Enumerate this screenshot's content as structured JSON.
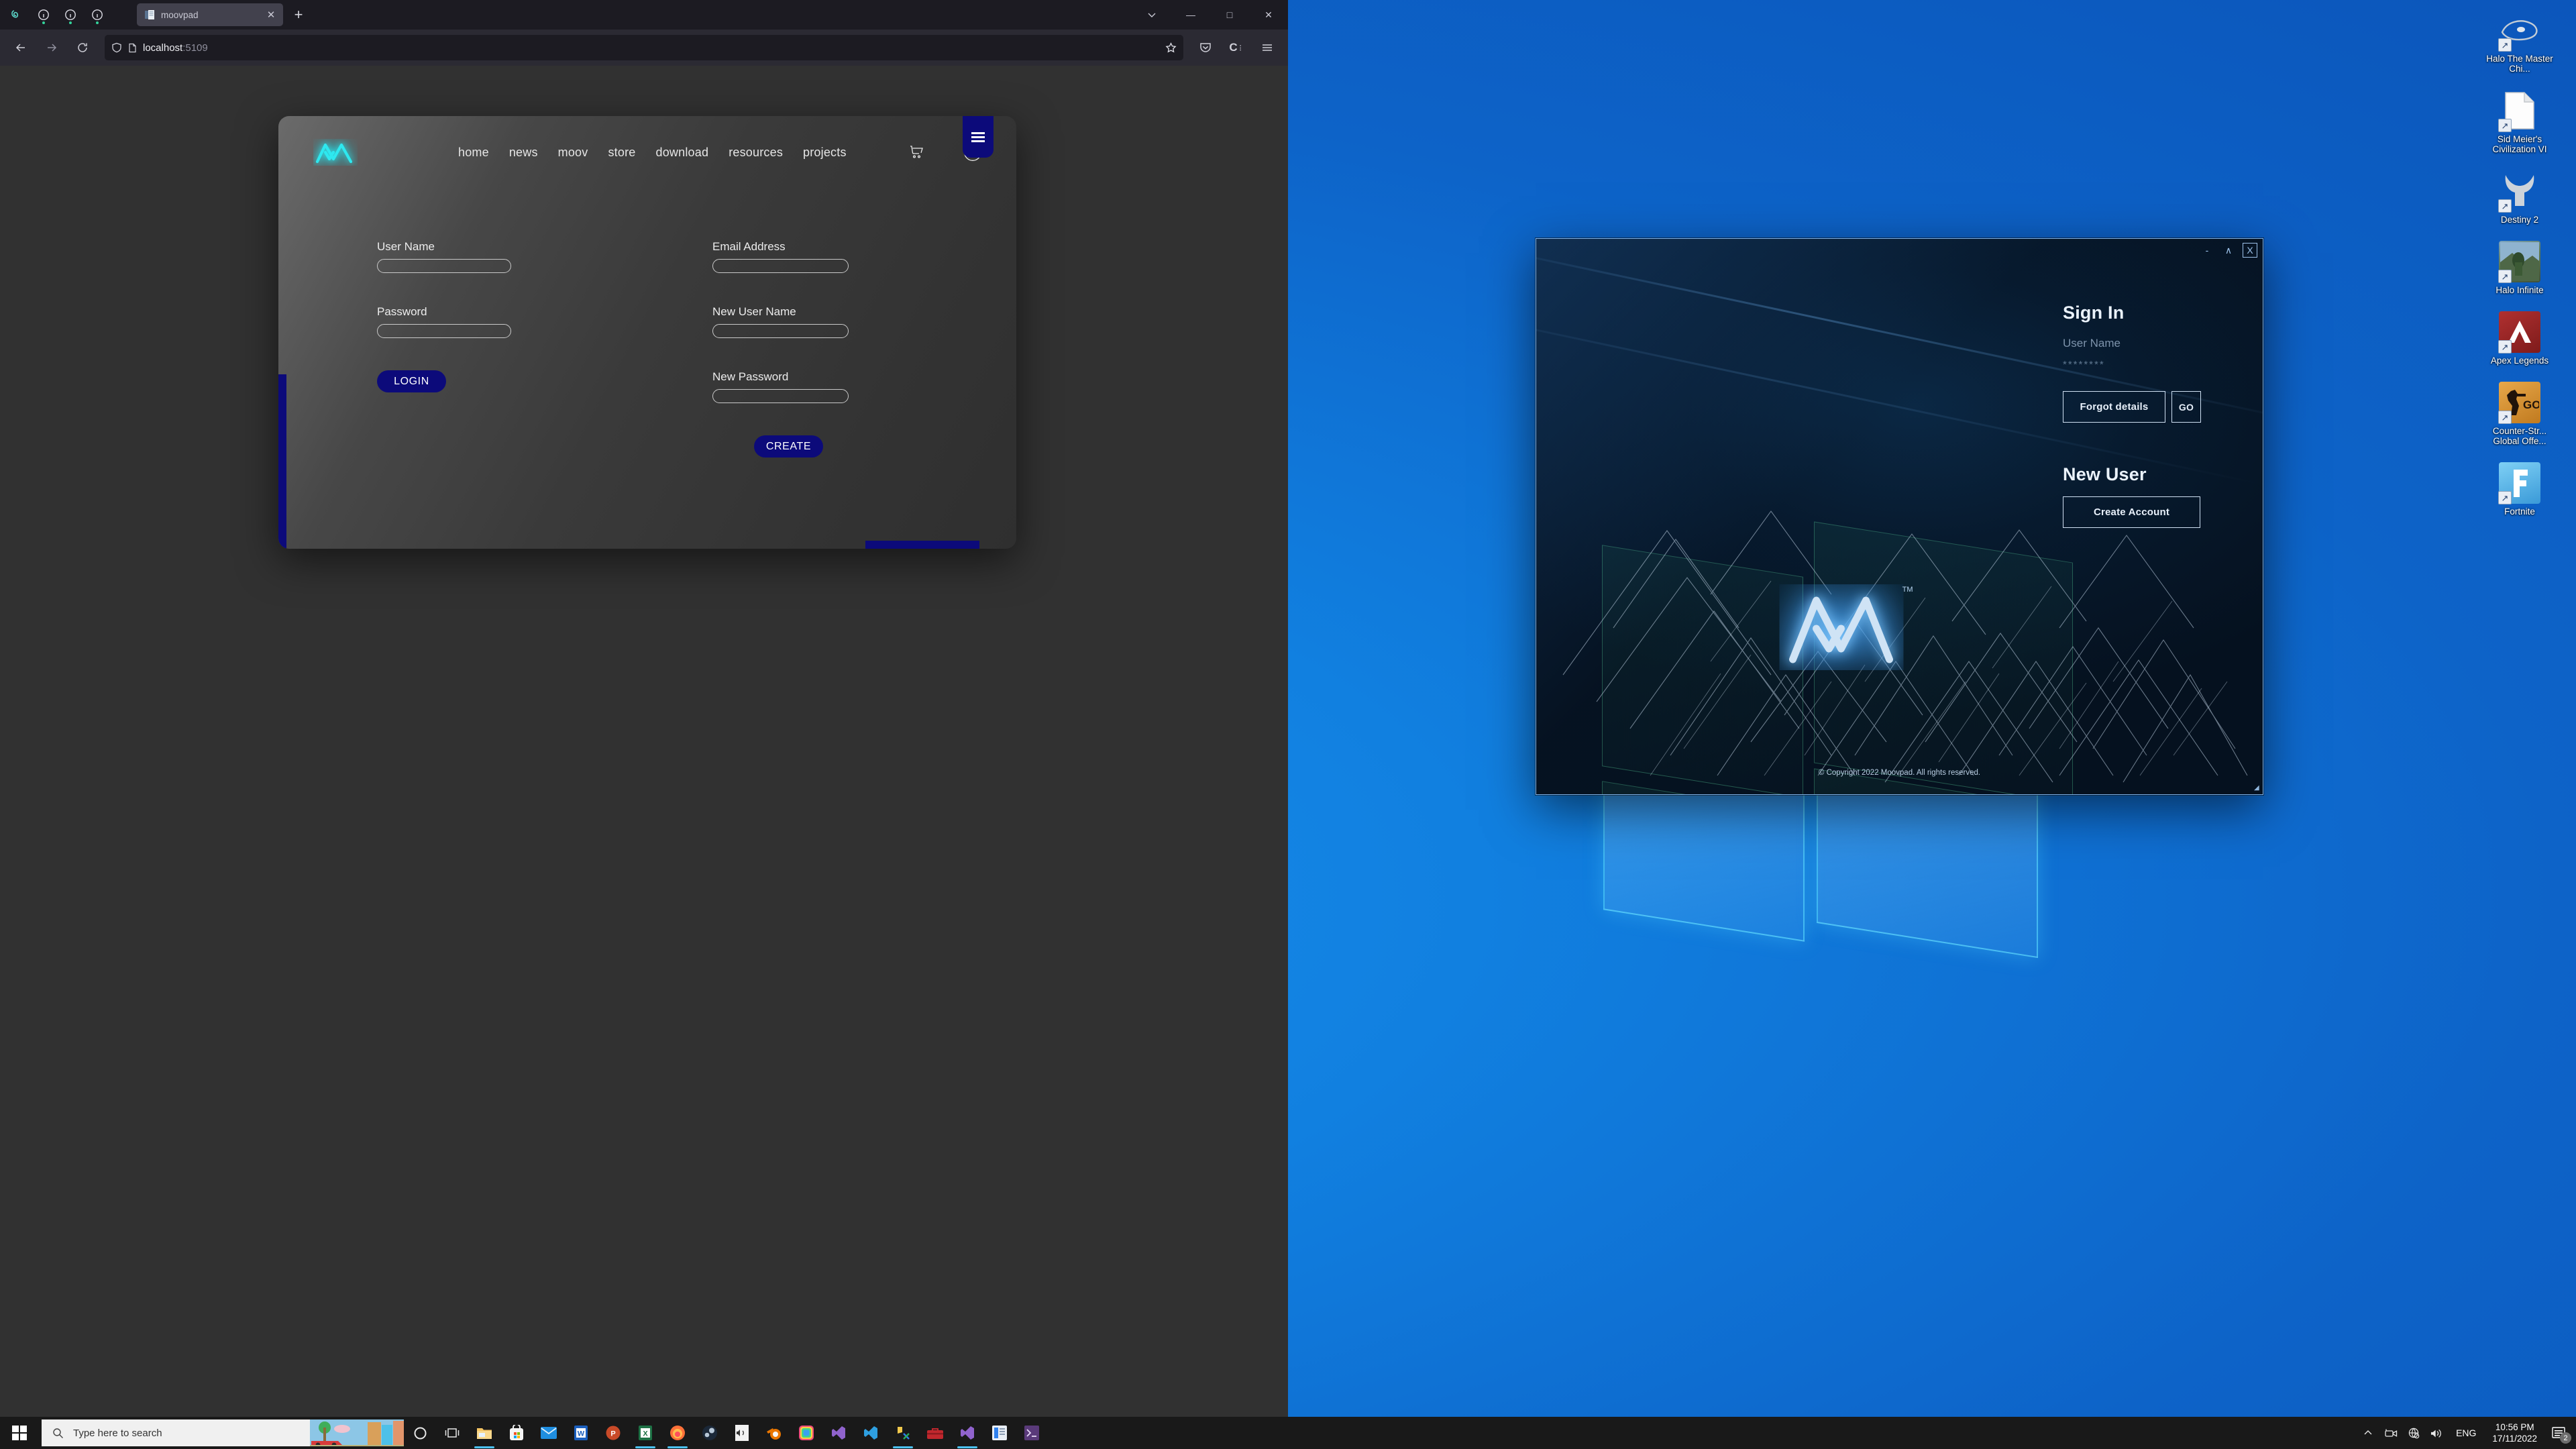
{
  "browser": {
    "tab": {
      "title": "moovpad",
      "favicon_icon": "document-icon",
      "close_icon": "close-icon"
    },
    "new_tab_label": "+",
    "toolbar_icons": [
      "firefox-view-icon",
      "container-tab-icon",
      "container-tab-icon",
      "container-tab-icon"
    ],
    "window_controls": {
      "list_all_tabs": "chevron-down-icon",
      "minimize": "—",
      "maximize": "□",
      "close": "✕"
    },
    "nav": {
      "back": "back-icon",
      "forward": "forward-icon",
      "reload": "reload-icon"
    },
    "urlbar": {
      "shield_icon": "shield-icon",
      "page_icon": "document-icon",
      "host": "localhost",
      "port": ":5109",
      "bookmark_icon": "star-icon"
    },
    "right_icons": [
      "pocket-icon",
      "container-icon",
      "hamburger-menu-icon"
    ]
  },
  "site": {
    "logo_alt": "moovpad-m-logo",
    "menu": [
      "home",
      "news",
      "moov",
      "store",
      "download",
      "resources",
      "projects"
    ],
    "nav_icons": {
      "cart": "shopping-cart-icon",
      "account": "account-circle-icon",
      "hamburger": "hamburger-menu-icon"
    },
    "login_form": {
      "fields": [
        {
          "label": "User Name",
          "value": "",
          "placeholder": ""
        },
        {
          "label": "Password",
          "value": "",
          "placeholder": ""
        }
      ],
      "submit_label": "LOGIN"
    },
    "register_form": {
      "fields": [
        {
          "label": "Email Address",
          "value": "",
          "placeholder": ""
        },
        {
          "label": "New User Name",
          "value": "",
          "placeholder": ""
        },
        {
          "label": "New Password",
          "value": "",
          "placeholder": ""
        }
      ],
      "submit_label": "CREATE"
    },
    "accent_color": "#0c0a7a",
    "logo_color": "#2ee8ef"
  },
  "signin_window": {
    "title_controls": {
      "minimize": "-",
      "maximize": "∧",
      "close": "X"
    },
    "heading": "Sign In",
    "username_placeholder": "User Name",
    "password_masked": "********",
    "forgot_label": "Forgot details",
    "go_label": "GO",
    "new_user_heading": "New User",
    "create_account_label": "Create Account",
    "copyright": "Copyright 2022 Moovpad. All rights reserved.",
    "copyright_symbol": "©",
    "logo_alt": "moovpad-m-logo",
    "logo_tm": "TM",
    "resize_grip": "resize-grip-icon"
  },
  "desktop": {
    "icons": [
      {
        "label": "Halo The Master Chi...",
        "icon": "halo-mcc-icon",
        "color": "#b9c2cc"
      },
      {
        "label": "Sid Meier's Civilization VI",
        "icon": "generic-file-icon",
        "color": "#ffffff"
      },
      {
        "label": "Destiny 2",
        "icon": "destiny2-icon",
        "color": "#c8ccd2"
      },
      {
        "label": "Halo Infinite",
        "icon": "halo-infinite-icon",
        "color": "#5f7a52"
      },
      {
        "label": "Apex Legends",
        "icon": "apex-legends-icon",
        "color": "#9b2323"
      },
      {
        "label": "Counter-Str... Global Offe...",
        "icon": "csgo-icon",
        "color": "#d9962f"
      },
      {
        "label": "Fortnite",
        "icon": "fortnite-icon",
        "color": "#4db3e8"
      }
    ]
  },
  "taskbar": {
    "start_icon": "windows-start-icon",
    "search_placeholder": "Type here to search",
    "search_icon": "search-icon",
    "pinned": [
      {
        "name": "cortana-icon",
        "running": false
      },
      {
        "name": "task-view-icon",
        "running": false
      },
      {
        "name": "file-explorer-icon",
        "running": true
      },
      {
        "name": "microsoft-store-icon",
        "running": false
      },
      {
        "name": "mail-icon",
        "running": false
      },
      {
        "name": "word-icon",
        "running": false
      },
      {
        "name": "powerpoint-icon",
        "running": false
      },
      {
        "name": "excel-icon",
        "running": true
      },
      {
        "name": "firefox-icon",
        "running": true
      },
      {
        "name": "steam-icon",
        "running": false
      },
      {
        "name": "media-player-icon",
        "running": false
      },
      {
        "name": "blender-icon",
        "running": false
      },
      {
        "name": "photos-icon",
        "running": false
      },
      {
        "name": "visual-studio-icon",
        "running": false
      },
      {
        "name": "vs-code-icon",
        "running": false
      },
      {
        "name": "dev-tools-icon",
        "running": true
      },
      {
        "name": "toolbox-icon",
        "running": false
      },
      {
        "name": "visual-studio-icon",
        "running": true
      },
      {
        "name": "sticky-notes-icon",
        "running": true
      },
      {
        "name": "terminal-icon",
        "running": false
      }
    ],
    "tray": {
      "overflow_icon": "chevron-up-icon",
      "camera_icon": "camera-off-icon",
      "network_icon": "network-disconnected-icon",
      "volume_icon": "volume-icon",
      "language": "ENG",
      "time": "10:56 PM",
      "date": "17/11/2022",
      "action_center_icon": "action-center-icon",
      "notification_count": "2"
    }
  }
}
